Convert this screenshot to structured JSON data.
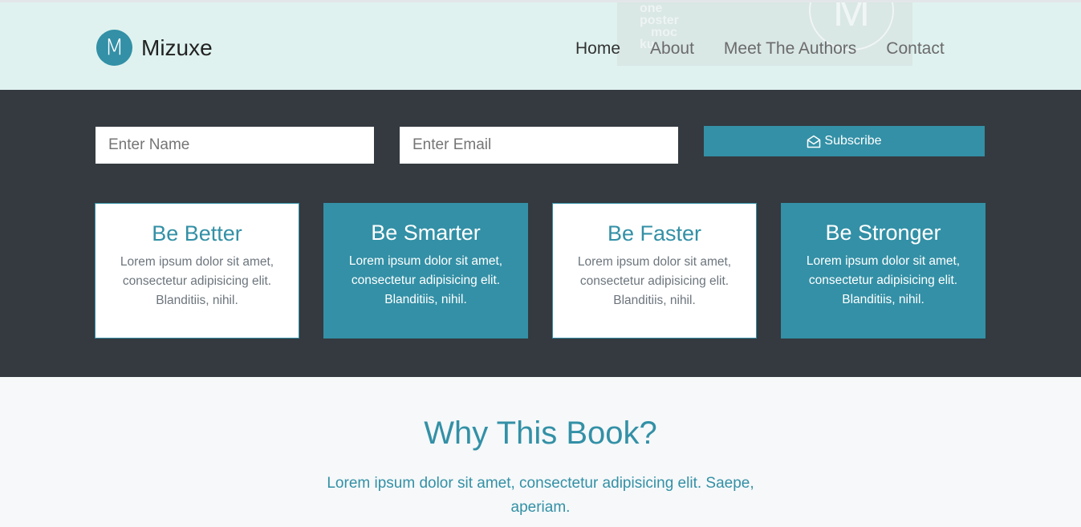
{
  "nav": {
    "logo_letter": "M",
    "brand": "Mizuxe",
    "links": [
      "Home",
      "About",
      "Meet The Authors",
      "Contact"
    ],
    "ghost_text": [
      "one",
      "poster",
      "moc",
      "ku"
    ],
    "ghost_letter": "M"
  },
  "subscribe": {
    "name_placeholder": "Enter Name",
    "email_placeholder": "Enter Email",
    "button_label": "Subscribe"
  },
  "cards": [
    {
      "title": "Be Better",
      "text": "Lorem ipsum dolor sit amet, consectetur adipisicing elit. Blanditiis, nihil."
    },
    {
      "title": "Be Smarter",
      "text": "Lorem ipsum dolor sit amet, consectetur adipisicing elit. Blanditiis, nihil."
    },
    {
      "title": "Be Faster",
      "text": "Lorem ipsum dolor sit amet, consectetur adipisicing elit. Blanditiis, nihil."
    },
    {
      "title": "Be Stronger",
      "text": "Lorem ipsum dolor sit amet, consectetur adipisicing elit. Blanditiis, nihil."
    }
  ],
  "why": {
    "title": "Why This Book?",
    "text": "Lorem ipsum dolor sit amet, consectetur adipisicing elit. Saepe, aperiam."
  },
  "colors": {
    "accent": "#3390a6",
    "dark": "#343a40",
    "navbar_bg": "#dff2ef"
  },
  "icons": {
    "subscribe": "envelope-open-icon"
  }
}
